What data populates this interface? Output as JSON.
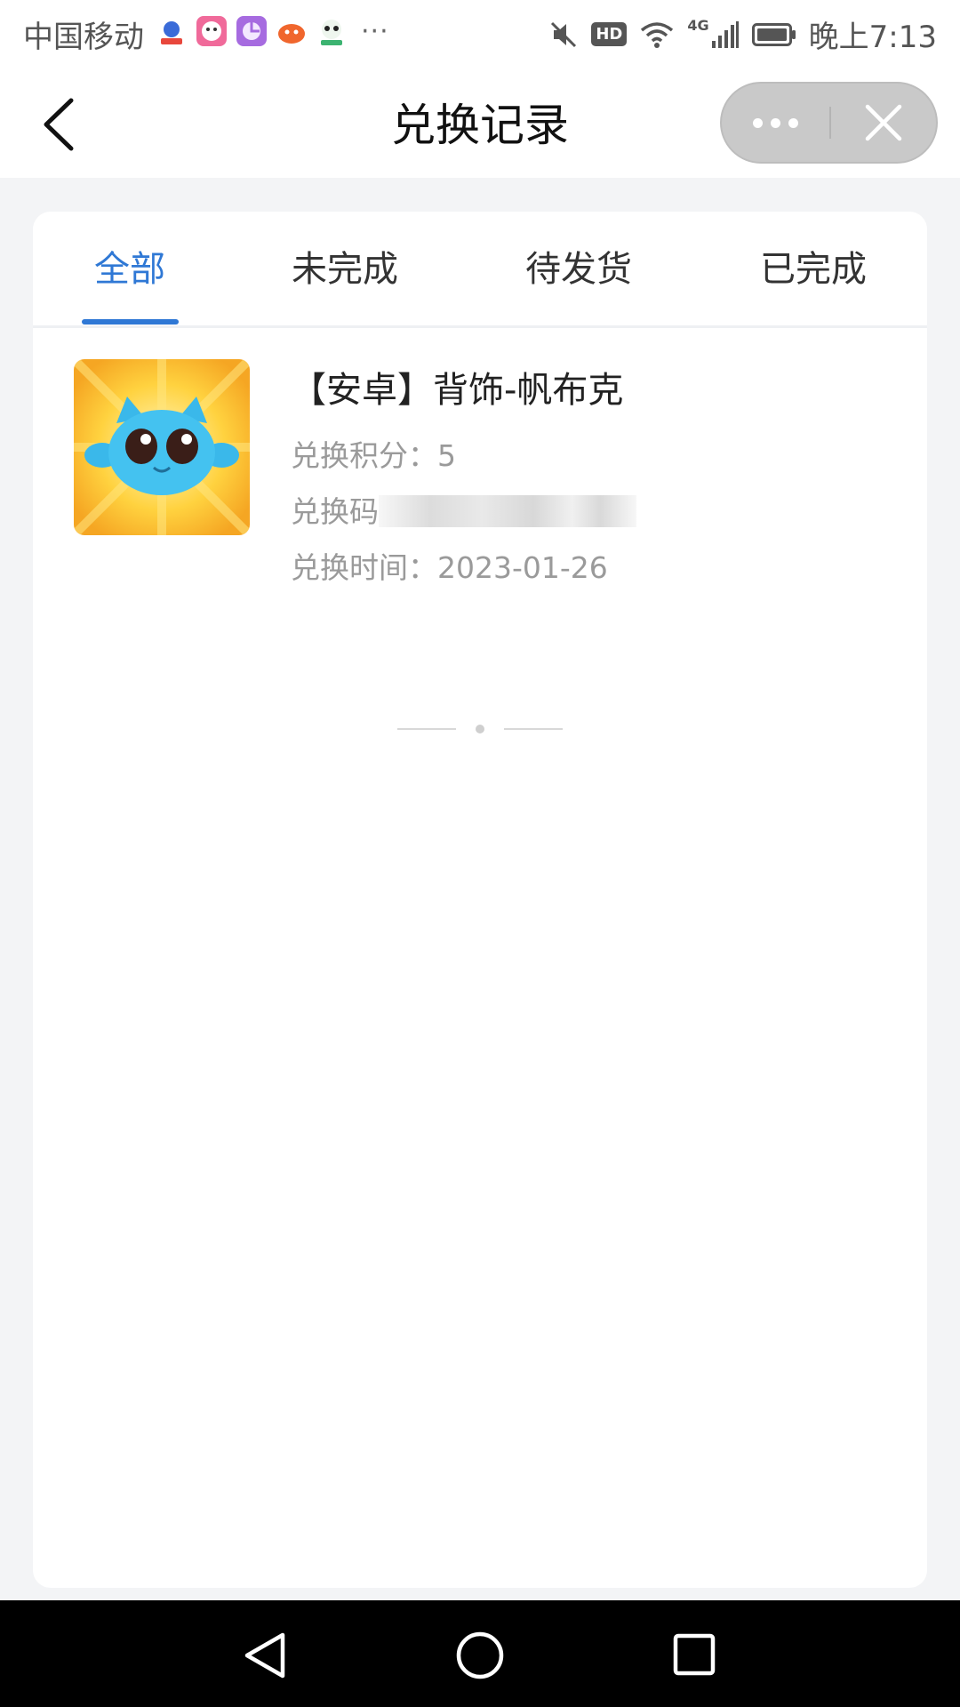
{
  "status_bar": {
    "carrier": "中国移动",
    "notification_icons": [
      "baidu-icon",
      "sticker-app-icon",
      "sheet-app-icon",
      "game-app-icon",
      "panda-app-icon"
    ],
    "more": "···",
    "hd_badge": "HD",
    "network": "4G",
    "time": "晚上7:13"
  },
  "navbar": {
    "title": "兑换记录",
    "back_icon": "chevron-left-icon",
    "capsule_more_icon": "more-dots-icon",
    "capsule_close_icon": "close-icon"
  },
  "tabs": [
    {
      "label": "全部",
      "active": true
    },
    {
      "label": "未完成",
      "active": false
    },
    {
      "label": "待发货",
      "active": false
    },
    {
      "label": "已完成",
      "active": false
    }
  ],
  "records": [
    {
      "title": "【安卓】背饰-帆布克",
      "points_label": "兑换积分：",
      "points": "5",
      "code_label": "兑换码",
      "time_label": "兑换时间：",
      "time": "2023-01-26"
    }
  ],
  "colors": {
    "accent": "#2f78d5",
    "page_bg": "#f3f4f6",
    "secondary_text": "#9a9a9a"
  }
}
